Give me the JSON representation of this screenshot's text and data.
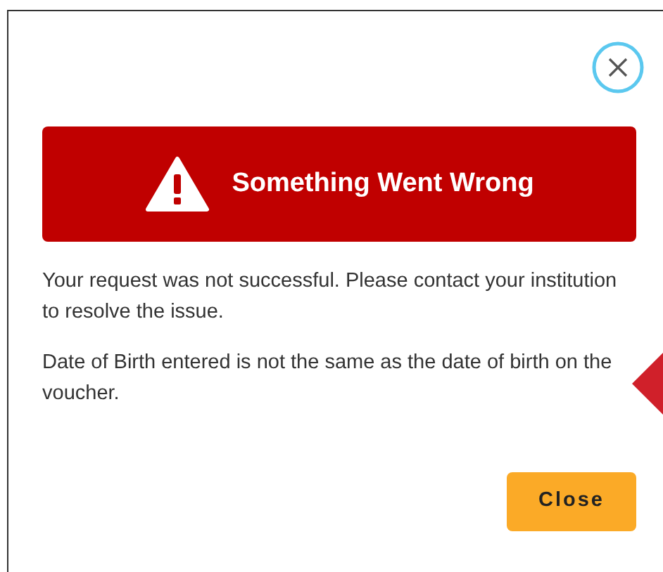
{
  "dialog": {
    "banner": {
      "title": "Something Went Wrong"
    },
    "messages": [
      "Your request was not successful. Please contact your institution to resolve the issue.",
      "Date of Birth entered is not the same as the date of birth on the voucher."
    ],
    "buttons": [
      {
        "label": "Close",
        "kind": "primary"
      }
    ]
  }
}
